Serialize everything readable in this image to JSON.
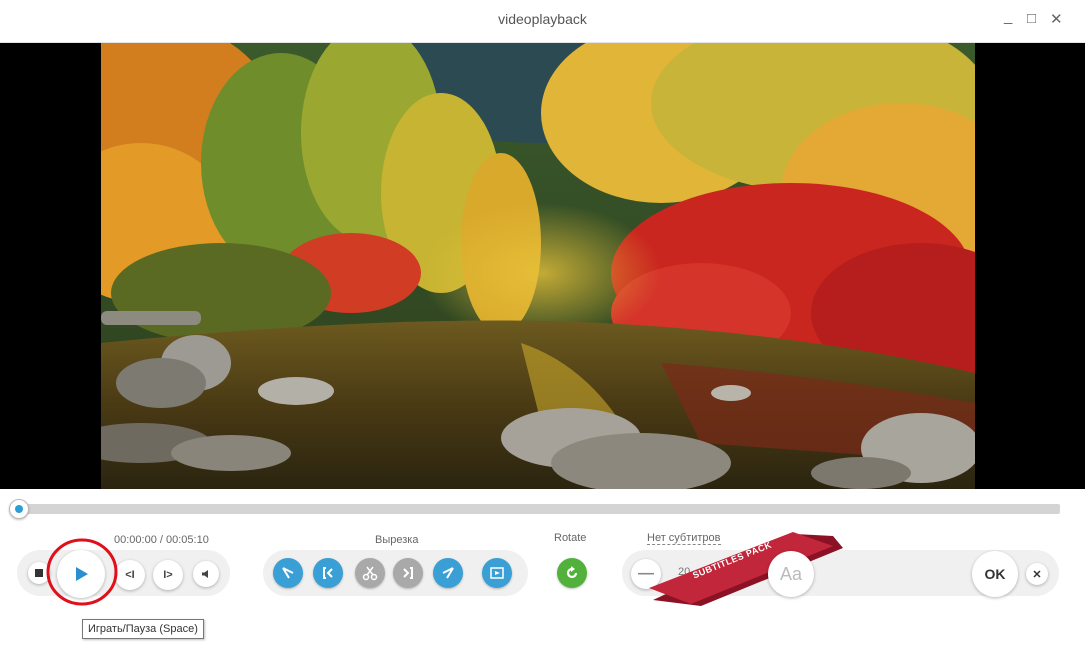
{
  "window": {
    "title": "videoplayback",
    "minimize": "_",
    "maximize": "□",
    "close": "✕"
  },
  "player": {
    "progress": 0.0
  },
  "controls": {
    "time_display": "00:00:00 / 00:05:10",
    "cut_label": "Вырезка",
    "rotate_label": "Rotate",
    "subtitles_label": "Нет субтитров",
    "font_size_value": "20",
    "font_button": "Aa",
    "ok_button": "OK",
    "close_button": "✕",
    "ribbon_text": "SUBTITLES PACK"
  },
  "tooltip": {
    "text": "Играть/Пауза (Space)"
  },
  "colors": {
    "accent_blue": "#3a9fd4",
    "rotate_green": "#52b13c",
    "ribbon_red": "#c2263a",
    "highlight_circle": "#e0101a"
  }
}
